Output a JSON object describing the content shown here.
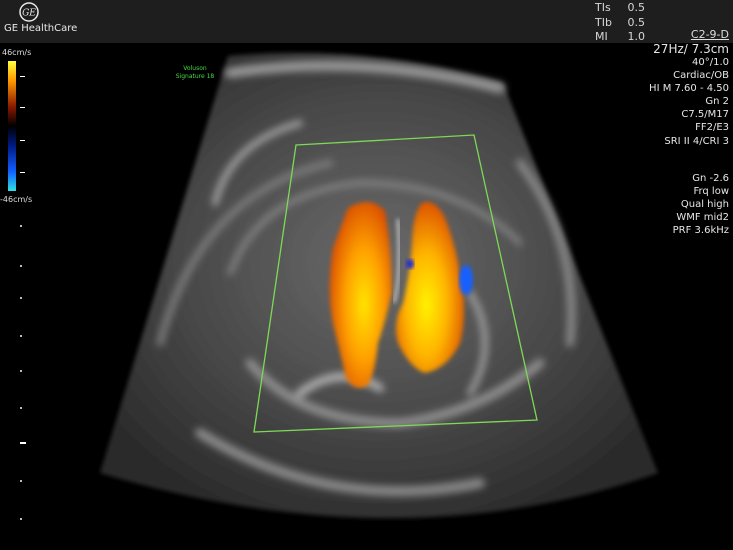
{
  "header": {
    "brand": "GE HealthCare",
    "logo_text": "GE",
    "indices": [
      {
        "key": "TIs",
        "value": "0.5"
      },
      {
        "key": "TIb",
        "value": "0.5"
      },
      {
        "key": "MI",
        "value": "1.0"
      }
    ]
  },
  "params": {
    "probe": "C2-9-D",
    "frame_depth": "27Hz/ 7.3cm",
    "lines": [
      "40°/1.0",
      "Cardiac/OB",
      "HI M  7.60 - 4.50",
      "Gn  2",
      "C7.5/M17",
      "FF2/E3",
      "SRI II 4/CRI 3"
    ],
    "color_lines": [
      "Gn -2.6",
      "Frq low",
      "Qual high",
      "WMF mid2",
      "PRF  3.6kHz"
    ]
  },
  "colorbar": {
    "top_label": "46cm/s",
    "bottom_label": "-46cm/s"
  },
  "watermark": {
    "line1": "Voluson",
    "line2": "Signature 18"
  },
  "colors": {
    "roi_box": "#7ed957",
    "flow_hot": "#ff8c00",
    "flow_cold": "#1560ff"
  }
}
